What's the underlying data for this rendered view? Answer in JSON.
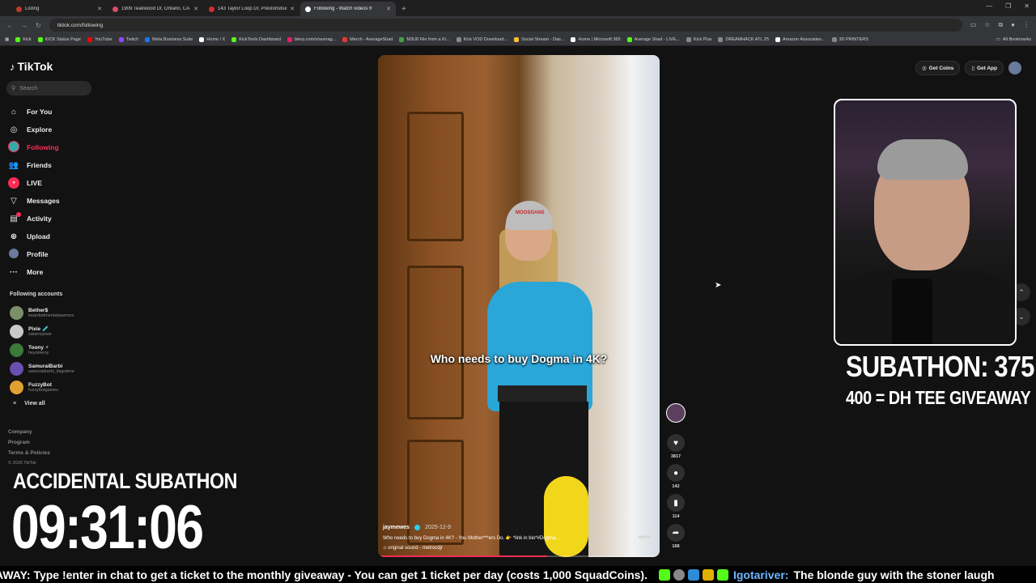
{
  "browser": {
    "tabs": [
      {
        "title": "Listing",
        "color": "#c0392b",
        "active": false
      },
      {
        "title": "1909 Teakwood Dr, Ontario, CA",
        "color": "#d94b6a",
        "active": false
      },
      {
        "title": "143 Taylor Loop Dr, Prestonsburg",
        "color": "#d32f2f",
        "active": false
      },
      {
        "title": "Following - Watch videos fr",
        "color": "#ffffff",
        "active": true
      }
    ],
    "new_tab": "+",
    "url": "tiktok.com/following",
    "bookmarks": [
      {
        "label": "Kick",
        "color": "#53fc18"
      },
      {
        "label": "KICK Status Page",
        "color": "#53fc18"
      },
      {
        "label": "YouTube",
        "color": "#ff0000"
      },
      {
        "label": "Twitch",
        "color": "#9146ff"
      },
      {
        "label": "Meta Business Suite",
        "color": "#1877f2"
      },
      {
        "label": "Home / X",
        "color": "#ffffff"
      },
      {
        "label": "KickTools Dashboard",
        "color": "#53fc18"
      },
      {
        "label": "blerp.com/x/averag...",
        "color": "#e91e63"
      },
      {
        "label": "Merch - AverageShad",
        "color": "#e53935"
      },
      {
        "label": "M3U8 File from a Ki...",
        "color": "#43a047"
      },
      {
        "label": "Kick VOD Download...",
        "color": "#888888"
      },
      {
        "label": "Social Stream - Das...",
        "color": "#fbc02d"
      },
      {
        "label": "Home | Microsoft 365",
        "color": "#ffffff"
      },
      {
        "label": "Average Shad - LIVE...",
        "color": "#53fc18"
      },
      {
        "label": "Kick Plus",
        "color": "#888888"
      },
      {
        "label": "DREAMHACK ATL 25",
        "color": "#888888"
      },
      {
        "label": "Amazon Associates...",
        "color": "#ffffff"
      },
      {
        "label": "3D PRINTERS",
        "color": "#888888"
      }
    ],
    "all_bookmarks": "All Bookmarks"
  },
  "tiktok": {
    "logo": "TikTok",
    "search_placeholder": "Search",
    "nav": [
      {
        "label": "For You",
        "icon": "home-icon",
        "glyph": "⌂",
        "active": false
      },
      {
        "label": "Explore",
        "icon": "compass-icon",
        "glyph": "◎",
        "active": false
      },
      {
        "label": "Following",
        "icon": "following-avatar-icon",
        "glyph": "●",
        "active": true
      },
      {
        "label": "Friends",
        "icon": "friends-icon",
        "glyph": "👥",
        "active": false
      },
      {
        "label": "LIVE",
        "icon": "live-icon",
        "glyph": "LIVE",
        "active": false
      },
      {
        "label": "Messages",
        "icon": "messages-icon",
        "glyph": "▽",
        "active": false
      },
      {
        "label": "Activity",
        "icon": "activity-icon",
        "glyph": "▤",
        "active": false
      },
      {
        "label": "Upload",
        "icon": "upload-icon",
        "glyph": "⊕",
        "active": false
      },
      {
        "label": "Profile",
        "icon": "profile-icon",
        "glyph": "●",
        "active": false
      },
      {
        "label": "More",
        "icon": "more-icon",
        "glyph": "···",
        "active": false
      }
    ],
    "following_accounts_title": "Following accounts",
    "accounts": [
      {
        "name": "Bether$",
        "handle": "beardedmentalwarriors",
        "color": "#7a8f6a"
      },
      {
        "name": "Pixie 🧪",
        "handle": "satanicpixie",
        "color": "#c9c9c9"
      },
      {
        "name": "Toony ⚡",
        "handle": "heyoteeny",
        "color": "#3a7a3a"
      },
      {
        "name": "SamuraiBarbi",
        "handle": "samuraibarbi_itsgotime",
        "color": "#6a4fb0"
      },
      {
        "name": "FuzzyBot",
        "handle": "fuzzybotgames",
        "color": "#e0a030"
      }
    ],
    "view_all": "View all",
    "footer": [
      "Company",
      "Program",
      "Terms & Policies"
    ],
    "copyright": "© 2026 TikTok",
    "get_coins": "Get Coins",
    "get_app": "Get App"
  },
  "video": {
    "caption": "Who needs to buy Dogma in 4K?",
    "username": "jaymewes",
    "date": "2025-12-9",
    "description": "Who needs to buy Dogma in 4K? - You Mother***ers Do. 👉 *link in bio*#Dogma...",
    "more": "more",
    "sound": "original sound - metrocdjr",
    "progress": 0.6,
    "beanie_text": "MOOSGANS",
    "likes": "3817",
    "comments": "142",
    "saves": "114",
    "shares": "168"
  },
  "overlay": {
    "subathon": "SUBATHON: 375",
    "giveaway": "400 = DH TEE GIVEAWAY",
    "accidental": "ACCIDENTAL SUBATHON",
    "timer": "09:31:06",
    "ticker_text": "AWAY: Type !enter in chat to get a ticket to the monthly giveaway - You can get 1 ticket per day (costs 1,000 SquadCoins).",
    "chat_user": "Igotariver",
    "chat_message": "The blonde guy with the stoner laugh"
  }
}
